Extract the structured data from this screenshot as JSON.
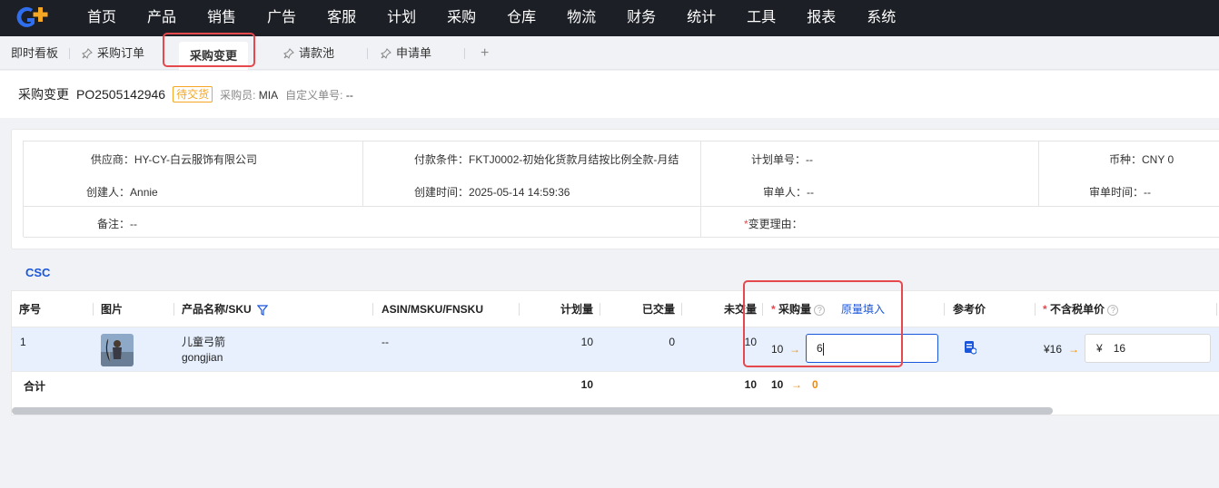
{
  "nav": {
    "logo": "G+",
    "items": [
      "首页",
      "产品",
      "销售",
      "广告",
      "客服",
      "计划",
      "采购",
      "仓库",
      "物流",
      "财务",
      "统计",
      "工具",
      "报表",
      "系统"
    ]
  },
  "tabs": {
    "dashboard": "即时看板",
    "purchase_order": "采购订单",
    "purchase_change": "采购变更",
    "payment_pool": "请款池",
    "requisition": "申请单",
    "add": "+"
  },
  "header": {
    "title": "采购变更",
    "po_number": "PO2505142946",
    "status": "待交货",
    "buyer_label": "采购员:",
    "buyer": "MIA",
    "custom_no_label": "自定义单号:",
    "custom_no": "--"
  },
  "info": {
    "supplier_label": "供应商：",
    "supplier": "HY-CY-白云服饰有限公司",
    "payment_label": "付款条件：",
    "payment": "FKTJ0002-初始化货款月结按比例全款-月结",
    "plan_no_label": "计划单号：",
    "plan_no": "--",
    "currency_label": "币种：",
    "currency": "CNY  0",
    "creator_label": "创建人：",
    "creator": "Annie",
    "created_time_label": "创建时间：",
    "created_time": "2025-05-14 14:59:36",
    "reviewer_label": "审单人：",
    "reviewer": "--",
    "review_time_label": "审单时间：",
    "review_time": "--",
    "remark_label": "备注：",
    "remark": "--",
    "change_reason_label": "变更理由："
  },
  "section": {
    "label": "CSC"
  },
  "table": {
    "headers": {
      "index": "序号",
      "image": "图片",
      "product": "产品名称/SKU",
      "asin": "ASIN/MSKU/FNSKU",
      "planned": "计划量",
      "delivered": "已交量",
      "undelivered": "未交量",
      "purchase_qty": "采购量",
      "fill_original": "原量填入",
      "ref_price": "参考价",
      "unit_price": "不含税单价"
    },
    "row": {
      "index": "1",
      "product_name": "儿童弓箭",
      "sku": "gongjian",
      "asin": "--",
      "planned": "10",
      "delivered": "0",
      "undelivered": "10",
      "qty_old": "10",
      "arrow": "→",
      "qty_new": "6",
      "price_old": "¥16",
      "currency_symbol": "¥",
      "price_new": "16"
    },
    "total": {
      "label": "合计",
      "planned": "10",
      "undelivered": "10",
      "qty_old": "10",
      "arrow": "→",
      "qty_new": "0"
    }
  },
  "colors": {
    "nav_bg": "#1c1f26",
    "accent": "#1a56db",
    "highlight": "#e5484d",
    "status": "#f5a623",
    "row_selected": "#e8f0fd"
  }
}
